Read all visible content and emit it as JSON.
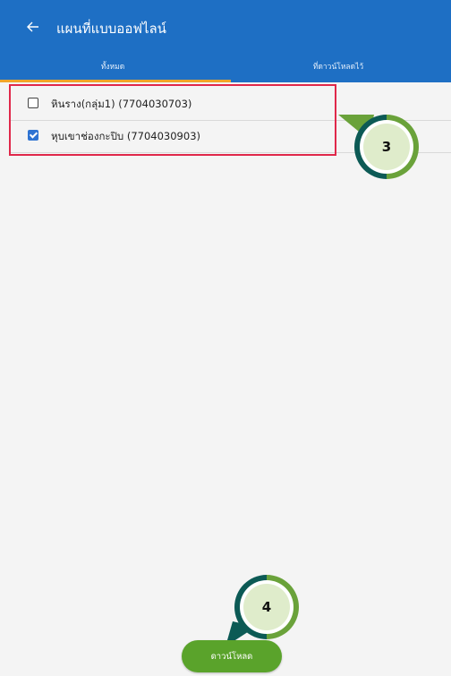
{
  "appbar": {
    "title": "แผนที่แบบออฟไลน์",
    "back_icon": "arrow-left-icon",
    "background": "#1e6fc4"
  },
  "tabs": [
    {
      "label": "ทั้งหมด",
      "active": true
    },
    {
      "label": "ที่ดาวน์โหลดไว้",
      "active": false
    }
  ],
  "list": {
    "items": [
      {
        "label": "หินราง(กลุ่ม1) (7704030703)",
        "checked": false
      },
      {
        "label": "หุบเขาช่องกะปิบ (7704030903)",
        "checked": true
      }
    ]
  },
  "callouts": {
    "step3": "3",
    "step4": "4"
  },
  "footer": {
    "download_label": "ดาวน์โหลด",
    "button_color": "#5aa32b"
  }
}
